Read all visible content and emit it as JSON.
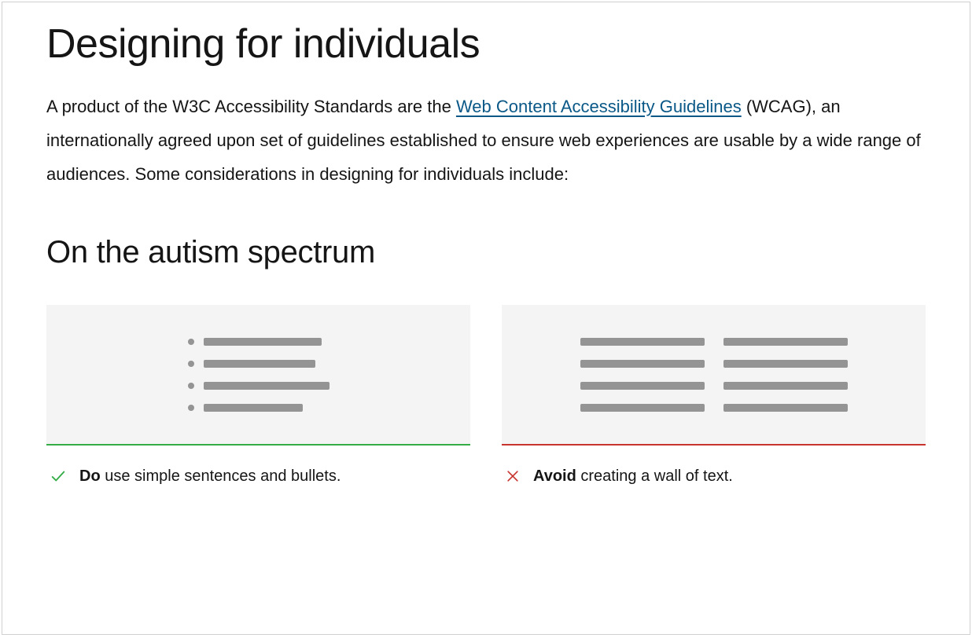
{
  "page": {
    "title": "Designing for individuals"
  },
  "intro": {
    "pre": "A product of the W3C Accessibility Standards are the ",
    "link_text": "Web Content Accessibility Guidelines",
    "post": " (WCAG), an internationally agreed upon set of guidelines established to ensure web experiences are usable by a wide range of audiences. Some considerations in designing for individuals include:"
  },
  "section": {
    "title": "On the autism spectrum"
  },
  "cards": {
    "do": {
      "label": "Do",
      "text": " use simple sentences and bullets."
    },
    "avoid": {
      "label": "Avoid",
      "text": " creating a wall of text."
    }
  },
  "colors": {
    "green": "#35ac46",
    "red": "#c7352e",
    "grey": "#949494",
    "panel": "#f4f4f4",
    "link": "#0a5887"
  }
}
